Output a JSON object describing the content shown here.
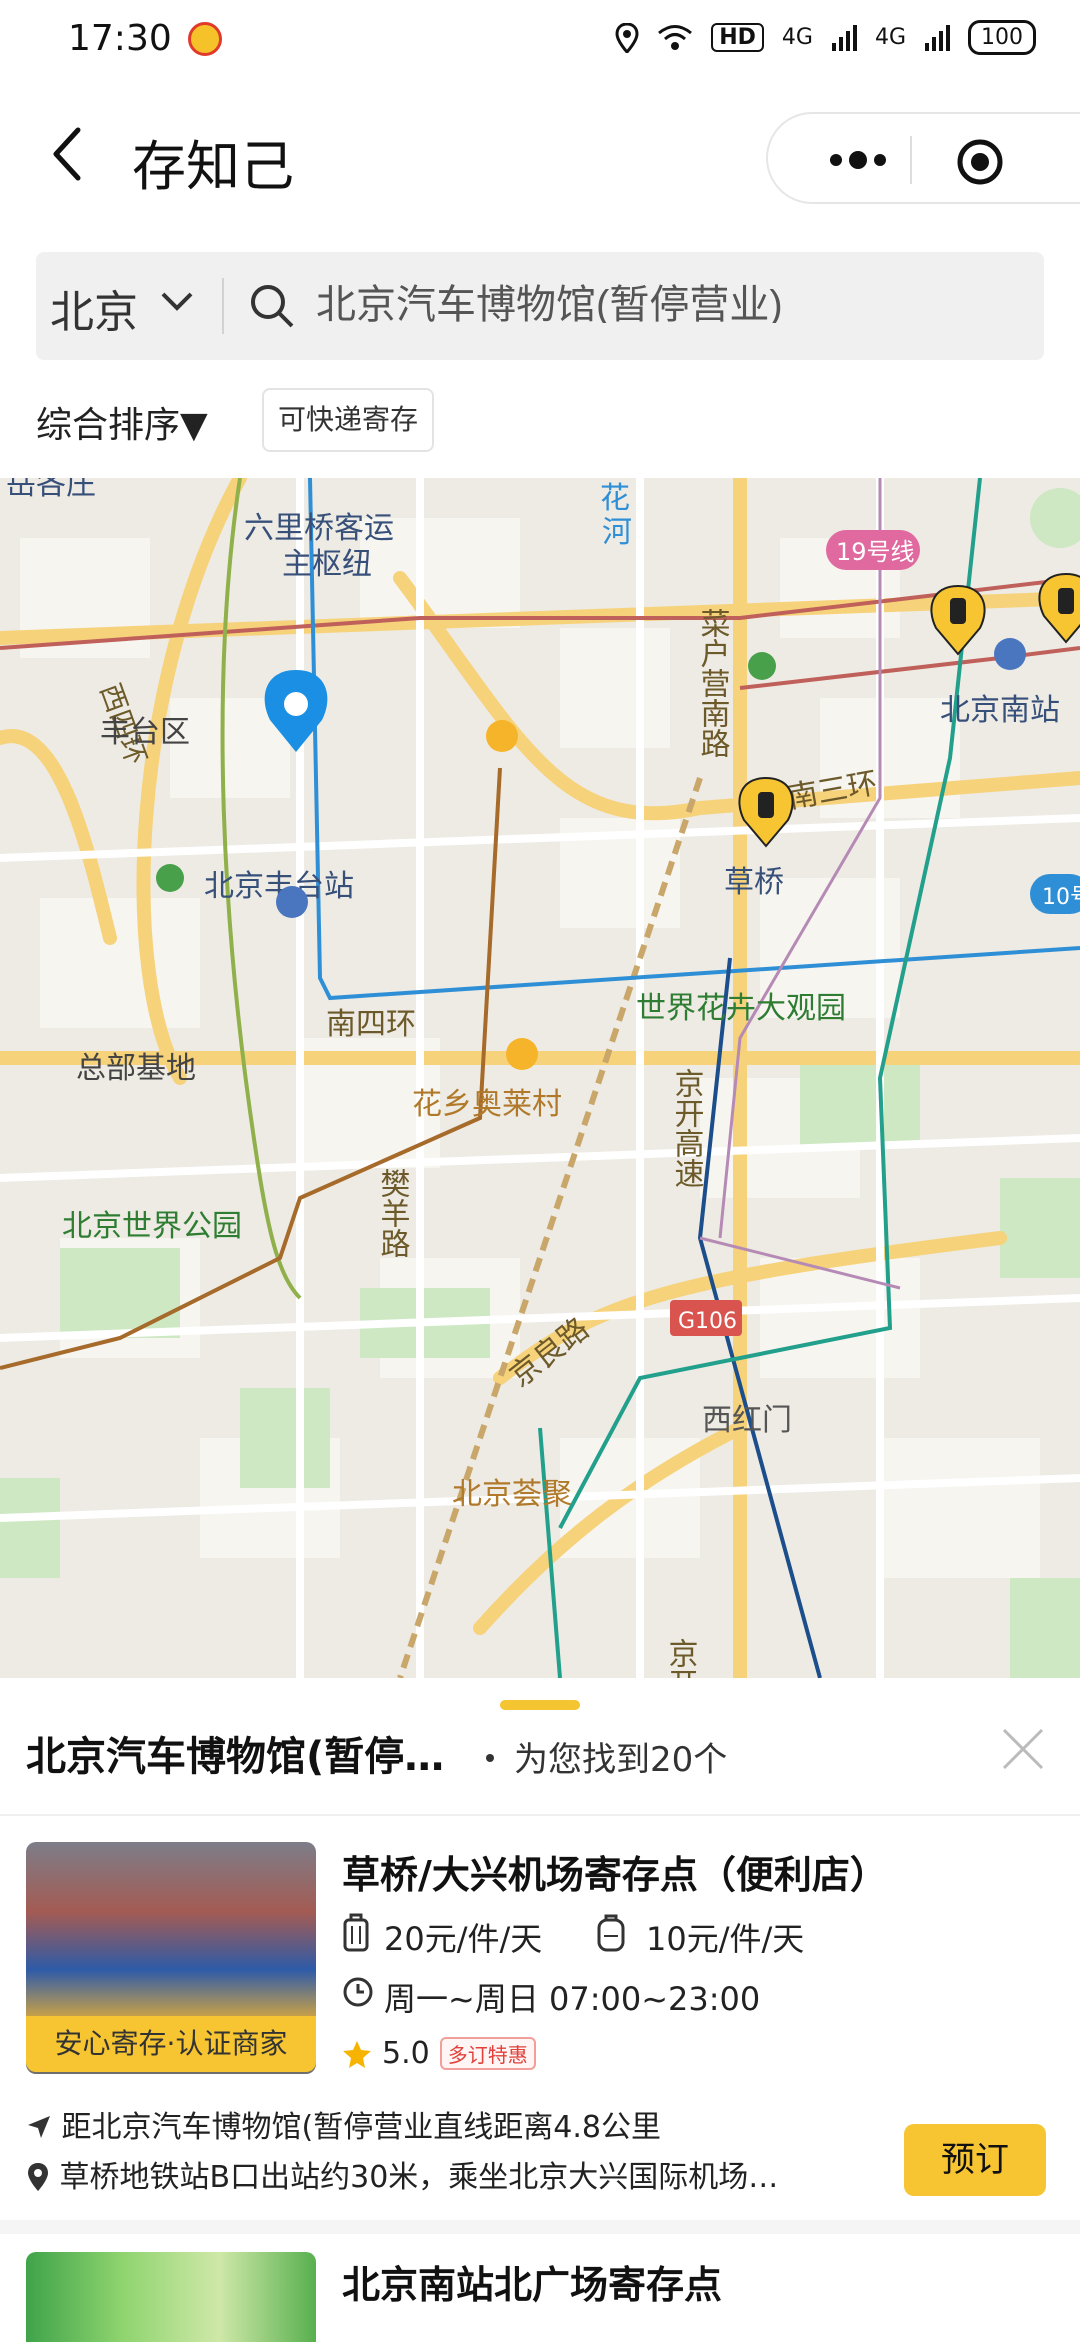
{
  "status_bar": {
    "time": "17:30",
    "network1": "HD",
    "network2": "4G",
    "network3": "4G",
    "battery": "100"
  },
  "nav": {
    "title": "存知己"
  },
  "search": {
    "city": "北京",
    "query": "北京汽车博物馆(暂停营业)"
  },
  "filters": {
    "sort_label": "综合排序▼",
    "chip": "可快递寄存"
  },
  "map": {
    "labels": {
      "l1": "岳各庄",
      "l2": "六里桥客运",
      "l3": "主枢纽",
      "l4": "花",
      "l5": "河",
      "l6": "西四环",
      "l7": "丰台区",
      "l8": "菜户营南路",
      "l9": "19号线",
      "l10": "北京南站",
      "l11": "南三环",
      "l12": "北京丰台站",
      "l13": "草桥",
      "l14": "10号",
      "l15": "南四环",
      "l16": "世界花卉大观园",
      "l17": "总部基地",
      "l18": "花乡奥莱村",
      "l19": "京开高速",
      "l20": "樊羊路",
      "l21": "北京世界公园",
      "l22": "G106",
      "l23": "京良路",
      "l24": "西红门",
      "l25": "北京荟聚",
      "l26": "京开"
    }
  },
  "sheet": {
    "title": "北京汽车博物馆(暂停…",
    "count": "为您找到20个",
    "items": [
      {
        "name": "草桥/大兴机场寄存点（便利店）",
        "price_luggage": "20元/件/天",
        "price_bag": "10元/件/天",
        "hours": "周一~周日 07:00~23:00",
        "rating": "5.0",
        "promo": "多订特惠",
        "badge": "安心寄存·认证商家",
        "distance": "距北京汽车博物馆(暂停营业直线距离4.8公里",
        "address": "草桥地铁站B口出站约30米，乘坐北京大兴国际机场…",
        "book": "预订"
      },
      {
        "name": "北京南站北广场寄存点"
      }
    ]
  },
  "colors": {
    "accent": "#f6c531",
    "pin_blue": "#1a8fe3",
    "road_yellow": "#f6d27a"
  }
}
